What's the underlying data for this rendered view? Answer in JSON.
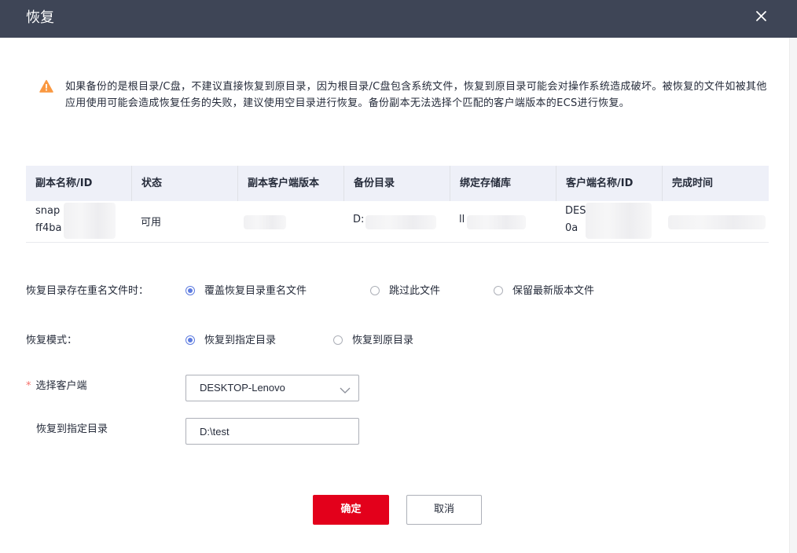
{
  "dialog": {
    "title": "恢复"
  },
  "warning": {
    "text": "如果备份的是根目录/C盘，不建议直接恢复到原目录，因为根目录/C盘包含系统文件，恢复到原目录可能会对操作系统造成破坏。被恢复的文件如被其他应用使用可能会造成恢复任务的失败，建议使用空目录进行恢复。备份副本无法选择个匹配的客户端版本的ECS进行恢复。"
  },
  "table": {
    "columns": [
      "副本名称/ID",
      "状态",
      "副本客户端版本",
      "备份目录",
      "绑定存储库",
      "客户端名称/ID",
      "完成时间"
    ],
    "row": {
      "name_line1": "snap",
      "name_line2": "ff4ba",
      "status": "可用",
      "backup_dir": "D:",
      "vault": "ll",
      "client_line1": "DES",
      "client_line2": "0a"
    }
  },
  "conflict": {
    "label": "恢复目录存在重名文件时：",
    "options": [
      "覆盖恢复目录重名文件",
      "跳过此文件",
      "保留最新版本文件"
    ],
    "selected": "覆盖恢复目录重名文件"
  },
  "mode": {
    "label": "恢复模式：",
    "options": [
      "恢复到指定目录",
      "恢复到原目录"
    ],
    "selected": "恢复到指定目录"
  },
  "client": {
    "required_mark": "*",
    "label": "选择客户端",
    "value": "DESKTOP-Lenovo"
  },
  "target_dir": {
    "label": "恢复到指定目录",
    "value": "D:\\test"
  },
  "buttons": {
    "confirm": "确定",
    "cancel": "取消"
  },
  "colors": {
    "header_bg": "#3e4556",
    "primary": "#e3001b",
    "radio_accent": "#5e7ce0",
    "warning": "#fa9841"
  }
}
